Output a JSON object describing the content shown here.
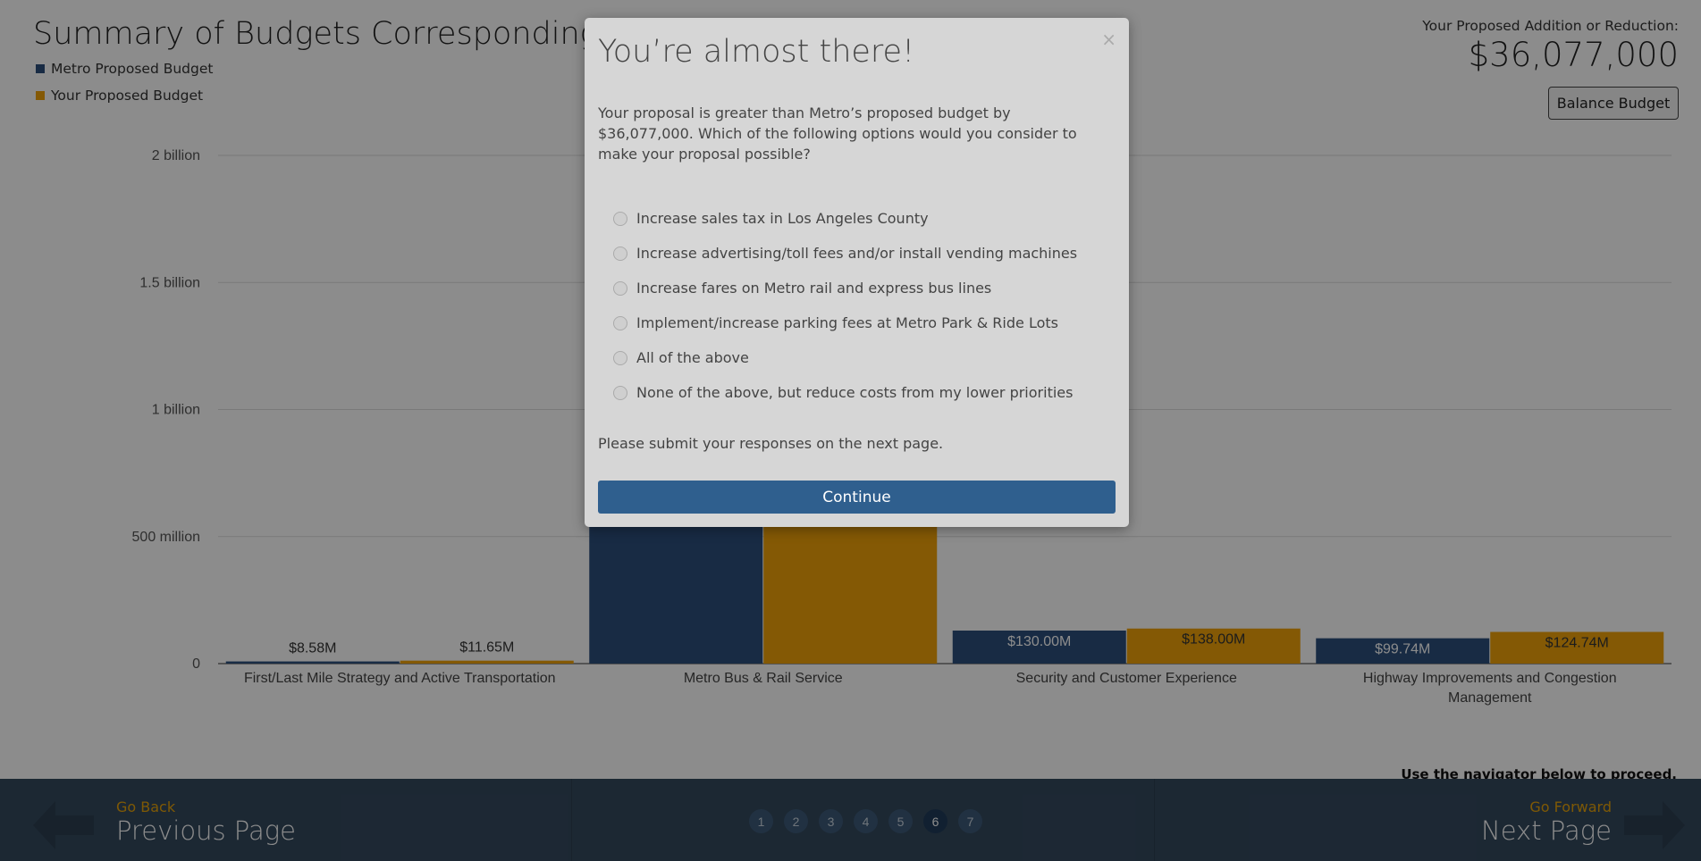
{
  "page": {
    "title": "Summary of Budgets Corresponding to",
    "legend": [
      {
        "label": "Metro Proposed Budget",
        "color": "#2c4f7c"
      },
      {
        "label": "Your Proposed Budget",
        "color": "#f0a30a"
      }
    ],
    "addition_label": "Your Proposed Addition or Reduction:",
    "addition_value": "$36,077,000",
    "balance_button": "Balance Budget",
    "nav_hint": "Use the navigator below to proceed."
  },
  "chart_data": {
    "type": "bar",
    "categories": [
      "First/Last Mile Strategy and Active Transportation",
      "Metro Bus & Rail Service",
      "Security and Customer Experience",
      "Highway Improvements and Congestion Management"
    ],
    "category_lines": [
      [
        "First/Last Mile Strategy and Active Transportation"
      ],
      [
        "Metro Bus & Rail Service"
      ],
      [
        "Security and Customer Experience"
      ],
      [
        "Highway Improvements and Congestion",
        "Management"
      ]
    ],
    "series": [
      {
        "name": "Metro Proposed Budget",
        "color": "#2c4f7c",
        "values": [
          8580000,
          550000000,
          130000000,
          99740000
        ],
        "labels": [
          "$8.58M",
          "",
          "$130.00M",
          "$99.74M"
        ]
      },
      {
        "name": "Your Proposed Budget",
        "color": "#f0a30a",
        "values": [
          11650000,
          550000000,
          138000000,
          124740000
        ],
        "labels": [
          "$11.65M",
          "",
          "$138.00M",
          "$124.74M"
        ]
      }
    ],
    "yticks": [
      {
        "value": 0,
        "label": "0"
      },
      {
        "value": 500000000,
        "label": "500 million"
      },
      {
        "value": 1000000000,
        "label": "1 billion"
      },
      {
        "value": 1500000000,
        "label": "1.5 billion"
      },
      {
        "value": 2000000000,
        "label": "2 billion"
      }
    ],
    "ylim": [
      0,
      2000000000
    ],
    "grid": true
  },
  "navigator": {
    "back_small": "Go Back",
    "back_big": "Previous Page",
    "forward_small": "Go Forward",
    "forward_big": "Next Page",
    "pages": [
      "1",
      "2",
      "3",
      "4",
      "5",
      "6",
      "7"
    ],
    "active_page": "6"
  },
  "modal": {
    "close": "×",
    "title": "You’re almost there!",
    "message": "Your proposal is greater than Metro’s proposed budget by $36,077,000. Which of the following options would you consider to make your proposal possible?",
    "options": [
      "Increase sales tax in Los Angeles County",
      "Increase advertising/toll fees and/or install vending machines",
      "Increase fares on Metro rail and express bus lines",
      "Implement/increase parking fees at Metro Park & Ride Lots",
      "All of the above",
      "None of the above, but reduce costs from my lower priorities"
    ],
    "submit_note": "Please submit your responses on the next page.",
    "continue_label": "Continue"
  }
}
